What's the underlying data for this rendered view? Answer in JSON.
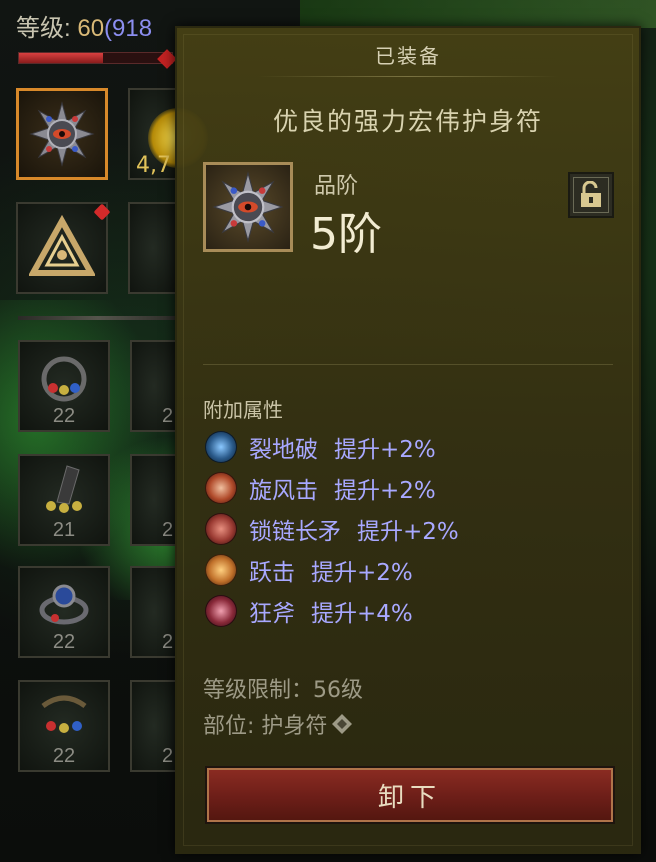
{
  "header": {
    "level_label": "等级: ",
    "level_value": "60",
    "xp_value": "(918"
  },
  "exp_bar": {
    "progress": 0.55
  },
  "inventory": {
    "gold_partial": "4,7",
    "slot_counts": [
      "22",
      "21",
      "22",
      "22"
    ],
    "right_partial_counts": [
      "2",
      "2",
      "2",
      "2"
    ]
  },
  "tooltip": {
    "status": "已装备",
    "item_name": "优良的强力宏伟护身符",
    "grade_label": "品阶",
    "grade_value": "5阶",
    "attributes_title": "附加属性",
    "attributes": [
      {
        "skill": "裂地破",
        "bonus": "提升+2%",
        "icon": "ground-crack-skill-icon",
        "color": "#2a5a8a"
      },
      {
        "skill": "旋风击",
        "bonus": "提升+2%",
        "icon": "whirlwind-skill-icon",
        "color": "#b04a2a"
      },
      {
        "skill": "锁链长矛",
        "bonus": "提升+2%",
        "icon": "chain-spear-skill-icon",
        "color": "#9a3a32"
      },
      {
        "skill": "跃击",
        "bonus": "提升+2%",
        "icon": "leap-skill-icon",
        "color": "#c0702a"
      },
      {
        "skill": "狂斧",
        "bonus": "提升+4%",
        "icon": "frenzy-axe-skill-icon",
        "color": "#8a2a3a"
      }
    ],
    "level_requirement": "等级限制：56级",
    "slot_type": "部位: 护身符",
    "unequip_label": "卸下"
  }
}
